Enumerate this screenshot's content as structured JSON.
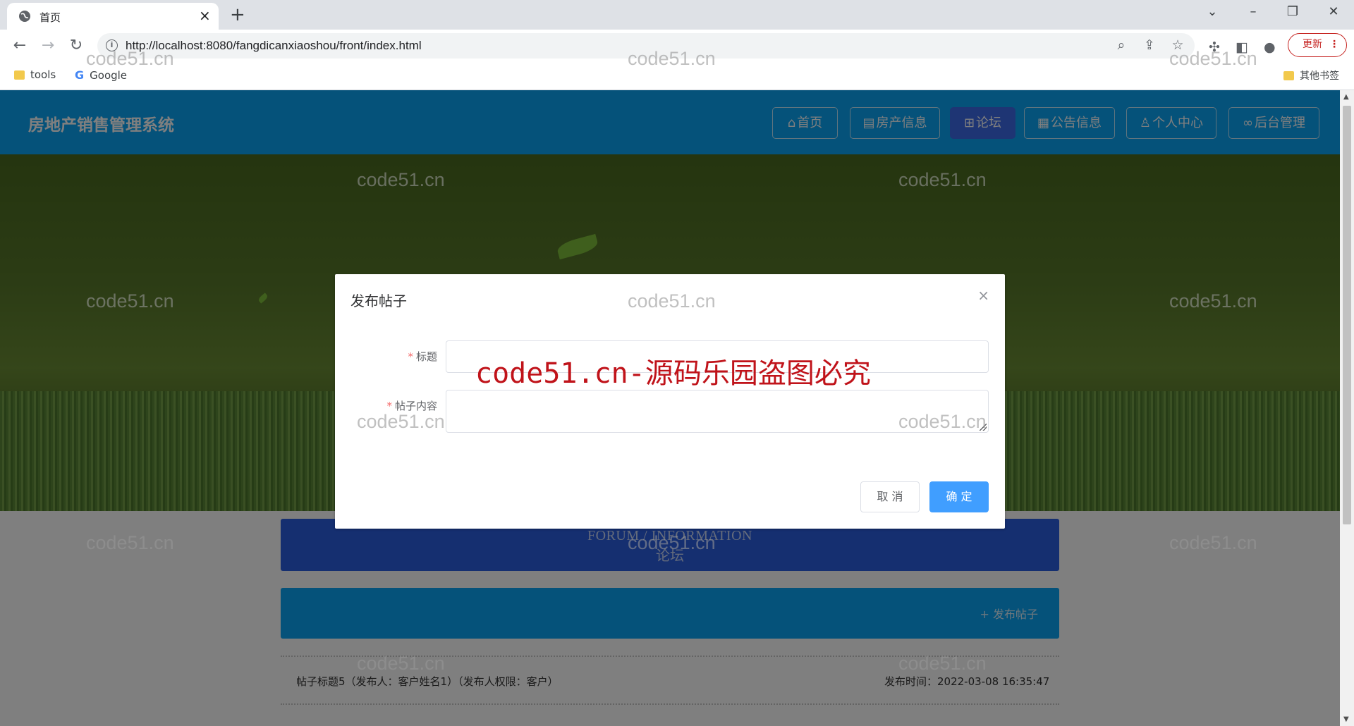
{
  "browser": {
    "tab_title": "首页",
    "url": "http://localhost:8080/fangdicanxiaoshou/front/index.html",
    "update_label": "更新",
    "bookmarks": [
      "tools",
      "Google"
    ],
    "other_bookmarks": "其他书签"
  },
  "header": {
    "site_title": "房地产销售管理系统",
    "nav": [
      {
        "label": "首页",
        "icon": "home-icon",
        "glyph": "⌂"
      },
      {
        "label": "房产信息",
        "icon": "document-icon",
        "glyph": "▤"
      },
      {
        "label": "论坛",
        "icon": "book-icon",
        "glyph": "⊞"
      },
      {
        "label": "公告信息",
        "icon": "grid-icon",
        "glyph": "▦"
      },
      {
        "label": "个人中心",
        "icon": "user-icon",
        "glyph": "♙"
      },
      {
        "label": "后台管理",
        "icon": "link-icon",
        "glyph": "∞"
      }
    ],
    "active_nav": "论坛",
    "colors": {
      "header_bg": "#0ba5f5",
      "active_bg": "#3d6be8"
    }
  },
  "forum": {
    "heading_en": "FORUM / INFORMATION",
    "heading_cn": "论坛",
    "post_button": "发布帖子",
    "post_button_icon": "+"
  },
  "posts": [
    {
      "title": "帖子标题5（发布人：客户姓名1）（发布人权限：客户）",
      "time": "发布时间：2022-03-08 16:35:47"
    }
  ],
  "dialog": {
    "title": "发布帖子",
    "fields": [
      {
        "label": "标题",
        "required": true,
        "value": ""
      },
      {
        "label": "帖子内容",
        "required": true,
        "value": ""
      }
    ],
    "cancel_label": "取 消",
    "confirm_label": "确 定",
    "close_glyph": "×"
  },
  "overlay_text": "code51.cn-源码乐园盗图必究",
  "watermark": "code51.cn"
}
